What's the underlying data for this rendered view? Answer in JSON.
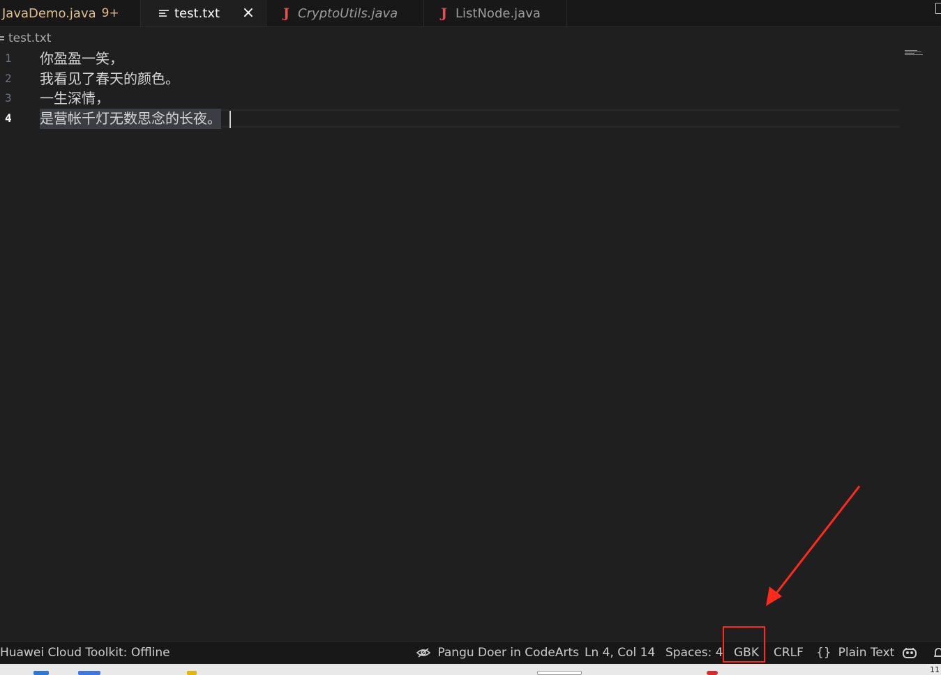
{
  "tabs": [
    {
      "label": "JavaDemo.java",
      "badge": "9+",
      "type": "java-modified"
    },
    {
      "label": "test.txt",
      "type": "text",
      "active": true
    },
    {
      "label": "CryptoUtils.java",
      "type": "java",
      "italic": true
    },
    {
      "label": "ListNode.java",
      "type": "java"
    }
  ],
  "icons": {
    "close": "×",
    "java": "J",
    "braces": "{}"
  },
  "breadcrumb": {
    "file": "test.txt"
  },
  "editor": {
    "lines": [
      {
        "number": "1",
        "text": "你盈盈一笑，"
      },
      {
        "number": "2",
        "text": "我看见了春天的颜色。"
      },
      {
        "number": "3",
        "text": "一生深情，"
      },
      {
        "number": "4",
        "text": "是营帐千灯无数思念的长夜。"
      }
    ],
    "current_line": 4
  },
  "statusbar": {
    "toolkit": "Huawei Cloud Toolkit: Offline",
    "pangu": "Pangu Doer in CodeArts",
    "position": "Ln 4, Col 14",
    "spaces": "Spaces: 4",
    "encoding": "GBK",
    "eol": "CRLF",
    "language": "Plain Text"
  },
  "taskbar": {
    "clock_fragment": "11"
  },
  "colors": {
    "annotation": "#ff2a1a",
    "modified": "#e2c08d",
    "java_icon": "#f14c4c",
    "editor_bg": "#1f1f1f",
    "chrome_bg": "#181818"
  }
}
